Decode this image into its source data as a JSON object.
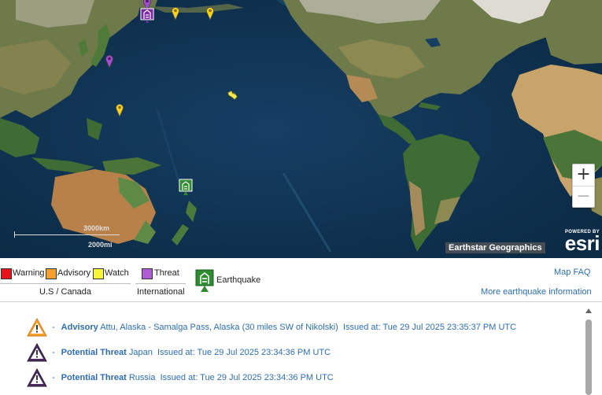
{
  "map": {
    "attribution": "Earthstar Geographics",
    "powered_by": "POWERED BY",
    "logo": "esri",
    "scale_km": "3000km",
    "scale_mi": "2000mi",
    "zoom_in": "+",
    "zoom_out": "−",
    "markers": [
      {
        "name": "watch-marker",
        "icon": "yellow-pin"
      },
      {
        "name": "watch-marker",
        "icon": "yellow-pin"
      },
      {
        "name": "watch-marker",
        "icon": "yellow-pin"
      },
      {
        "name": "threat-marker",
        "icon": "purple-pin"
      },
      {
        "name": "threat-marker",
        "icon": "purple-pin"
      },
      {
        "name": "earthquake-marker",
        "icon": "earthquake-icon"
      }
    ]
  },
  "legend": {
    "warning": "Warning",
    "advisory": "Advisory",
    "watch": "Watch",
    "threat": "Threat",
    "us_canada": "U.S / Canada",
    "international": "International",
    "earthquake": "Earthquake",
    "map_faq": "Map FAQ",
    "more_info": "More earthquake information",
    "colors": {
      "warning": "#e8141c",
      "advisory": "#f5a02b",
      "watch": "#f7f43a",
      "threat": "#b25bd6",
      "earthquake": "#2f8a32"
    }
  },
  "alerts": [
    {
      "type": "Advisory",
      "region": "Attu, Alaska - Samalga Pass, Alaska (30 miles SW of Nikolski)",
      "issued": "Issued at: Tue 29 Jul 2025 23:35:37 PM UTC",
      "icon": "advisory-triangle-icon"
    },
    {
      "type": "Potential Threat",
      "region": "Japan",
      "issued": "Issued at: Tue 29 Jul 2025 23:34:36 PM UTC",
      "icon": "threat-triangle-icon"
    },
    {
      "type": "Potential Threat",
      "region": "Russia",
      "issued": "Issued at: Tue 29 Jul 2025 23:34:36 PM UTC",
      "icon": "threat-triangle-icon"
    }
  ],
  "separator": "-"
}
